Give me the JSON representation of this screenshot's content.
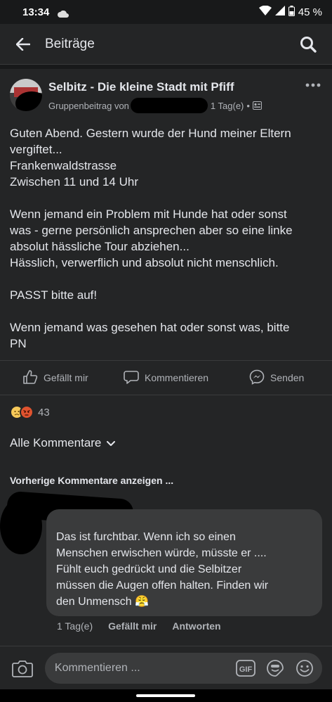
{
  "status_bar": {
    "time": "13:34",
    "battery": "45 %"
  },
  "app_bar": {
    "title": "Beiträge"
  },
  "post": {
    "group_name": "Selbitz - Die kleine Stadt mit Pfiff",
    "meta_prefix": "Gruppenbeitrag von",
    "time": "1 Tag(e)",
    "dot": "•",
    "text_lines": [
      "Guten Abend. Gestern wurde der Hund meiner Eltern",
      "vergiftet...",
      "Frankenwaldstrasse",
      "Zwischen 11 und 14 Uhr",
      "",
      "Wenn jemand ein Problem mit Hunde hat oder sonst",
      "was - gerne persönlich ansprechen aber so eine linke",
      "absolut hässliche Tour abziehen...",
      "Hässlich, verwerflich und absolut nicht menschlich.",
      "",
      "PASST bitte auf!",
      "",
      "Wenn jemand was gesehen hat oder sonst was, bitte",
      "PN"
    ],
    "actions": {
      "like": "Gefällt mir",
      "comment": "Kommentieren",
      "send": "Senden"
    },
    "reaction_count": "43"
  },
  "comments": {
    "filter_label": "Alle Kommentare",
    "previous_label": "Vorherige Kommentare anzeigen ...",
    "items": [
      {
        "text_lines": [
          "Das ist furchtbar. Wenn ich so einen",
          "Menschen erwischen würde, müsste er ....",
          "Fühlt euch gedrückt und die Selbitzer",
          "müssen die Augen offen halten. Finden wir",
          "den Unmensch"
        ],
        "emoji": "😤",
        "time": "1 Tag(e)",
        "like": "Gefällt mir",
        "reply": "Antworten"
      }
    ]
  },
  "composer": {
    "placeholder": "Kommentieren ...",
    "gif_label": "GIF"
  },
  "colors": {
    "background": "#18191a",
    "card": "#242526",
    "bubble": "#3a3b3c",
    "text_primary": "#e4e6eb",
    "text_secondary": "#b0b3b8"
  }
}
